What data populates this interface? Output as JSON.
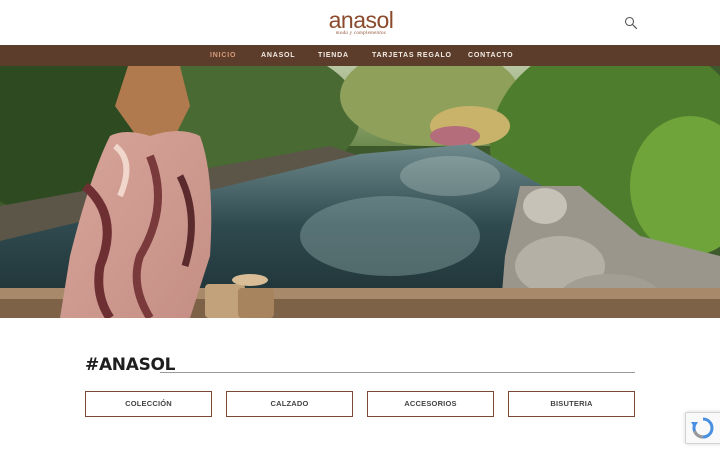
{
  "header": {
    "logo_word": "anasol",
    "logo_tagline": "moda y complementos"
  },
  "nav": {
    "items": [
      {
        "label": "INICIO",
        "active": true
      },
      {
        "label": "ANASOL",
        "active": false
      },
      {
        "label": "TIENDA",
        "active": false
      },
      {
        "label": "TARJETAS REGALO",
        "active": false
      },
      {
        "label": "CONTACTO",
        "active": false
      }
    ]
  },
  "section": {
    "title": "#ANASOL"
  },
  "categories": [
    {
      "label": "COLECCIÓN"
    },
    {
      "label": "CALZADO"
    },
    {
      "label": "ACCESORIOS"
    },
    {
      "label": "BISUTERIA"
    }
  ],
  "colors": {
    "nav_bg": "#5c3d2b",
    "brand": "#8a4a2b",
    "nav_active": "#d89a7a",
    "button_border": "#7a4a34"
  },
  "icons": {
    "search": "search-icon",
    "recaptcha": "recaptcha-icon"
  }
}
